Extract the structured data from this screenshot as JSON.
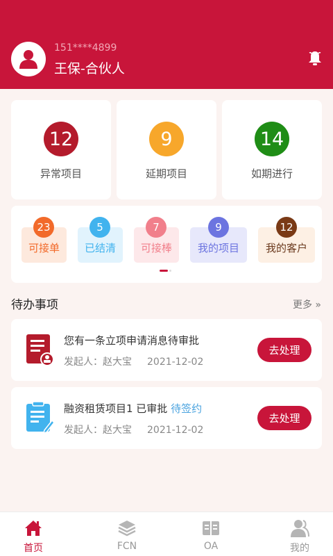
{
  "user": {
    "phone": "151****4899",
    "name": "王保-合伙人"
  },
  "stats": [
    {
      "value": "12",
      "label": "异常项目",
      "color": "#b41b2c"
    },
    {
      "value": "9",
      "label": "延期项目",
      "color": "#f7a72b"
    },
    {
      "value": "14",
      "label": "如期进行",
      "color": "#1f8d16"
    }
  ],
  "quick": [
    {
      "count": "23",
      "label": "可接单",
      "badge_color": "#f26a2a",
      "bg": "#fde9dd",
      "text_color": "#f26a2a"
    },
    {
      "count": "5",
      "label": "已结清",
      "badge_color": "#41b3ee",
      "bg": "#e1f3fd",
      "text_color": "#41b3ee"
    },
    {
      "count": "7",
      "label": "可接棒",
      "badge_color": "#f17f8b",
      "bg": "#fde8ea",
      "text_color": "#f17f8b"
    },
    {
      "count": "9",
      "label": "我的项目",
      "badge_color": "#6c74e0",
      "bg": "#e7e8fb",
      "text_color": "#6c74e0"
    },
    {
      "count": "12",
      "label": "我的客户",
      "badge_color": "#7a3a16",
      "bg": "#fdf0e4",
      "text_color": "#6b3a1e"
    }
  ],
  "section": {
    "title": "待办事项",
    "more": "更多"
  },
  "todos": [
    {
      "title": "您有一条立项申请消息待审批",
      "status": "",
      "initiator": "发起人：赵大宝",
      "date": "2021-12-02",
      "action": "去处理"
    },
    {
      "title": "融资租赁项目1 已审批",
      "status": "待签约",
      "initiator": "发起人：赵大宝",
      "date": "2021-12-02",
      "action": "去处理"
    }
  ],
  "tabs": [
    {
      "label": "首页",
      "active": true
    },
    {
      "label": "FCN",
      "active": false
    },
    {
      "label": "OA",
      "active": false
    },
    {
      "label": "我的",
      "active": false
    }
  ],
  "colors": {
    "brand": "#c8153a",
    "tab_active": "#c8153a",
    "tab_inactive": "#999999"
  }
}
